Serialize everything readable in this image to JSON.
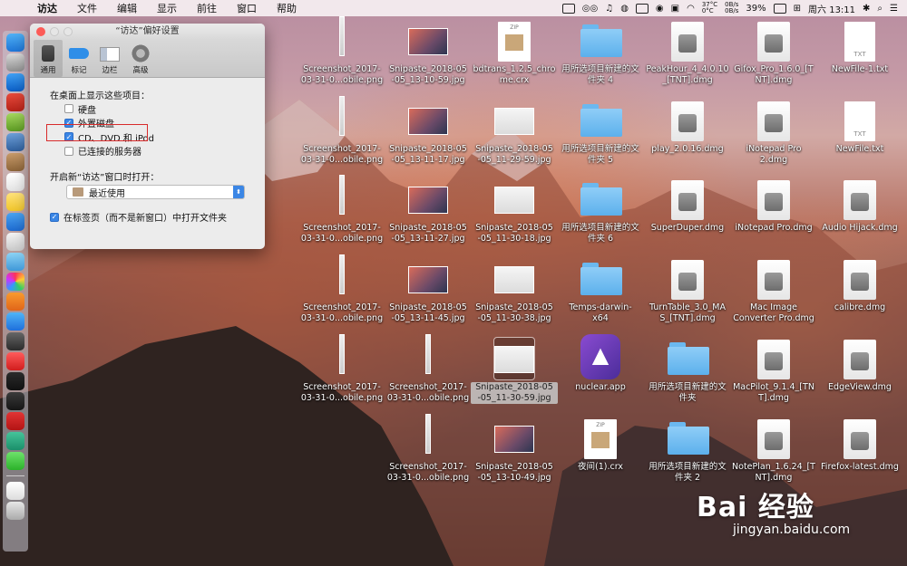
{
  "menubar": {
    "apple": "",
    "items": [
      "访达",
      "文件",
      "编辑",
      "显示",
      "前往",
      "窗口",
      "帮助"
    ],
    "status": {
      "temp": "37°C",
      "temp_sub": "0°C",
      "net_up": "0B/s",
      "net_down": "0B/s",
      "battery": "39%",
      "datetime": "周六 13:11"
    }
  },
  "prefs": {
    "title": "“访达”偏好设置",
    "tabs": [
      {
        "label": "通用",
        "icon": "general-icon"
      },
      {
        "label": "标记",
        "icon": "tag-icon"
      },
      {
        "label": "边栏",
        "icon": "sidebar-icon"
      },
      {
        "label": "高级",
        "icon": "gear-icon"
      }
    ],
    "section_heading": "在桌面上显示这些项目：",
    "checkboxes": [
      {
        "label": "硬盘",
        "checked": false
      },
      {
        "label": "外置磁盘",
        "checked": true
      },
      {
        "label": "CD、DVD 和 iPod",
        "checked": true
      },
      {
        "label": "已连接的服务器",
        "checked": false
      }
    ],
    "new_window_label": "开启新“访达”窗口时打开：",
    "new_window_value": "最近使用",
    "tabs_option": {
      "label": "在标签页（而不是新窗口）中打开文件夹",
      "checked": true
    }
  },
  "desktop": {
    "icons": [
      {
        "label": "Screenshot_2017-\n03-31-0...obile.png",
        "kind": "shot-tall"
      },
      {
        "label": "Screenshot_2017-\n03-31-0...obile.png",
        "kind": "shot-tall"
      },
      {
        "label": "Screenshot_2017-\n03-31-0...obile.png",
        "kind": "shot-tall"
      },
      {
        "label": "Screenshot_2017-\n03-31-0...obile.png",
        "kind": "shot-tall"
      },
      {
        "label": "Screenshot_2017-\n03-31-0...obile.png",
        "kind": "shot-tall"
      },
      {
        "label": "Snipaste_2018-05\n-05_13-10-59.jpg",
        "kind": "snip"
      },
      {
        "label": "Snipaste_2018-05\n-05_13-11-17.jpg",
        "kind": "snip"
      },
      {
        "label": "Snipaste_2018-05\n-05_13-11-27.jpg",
        "kind": "snip"
      },
      {
        "label": "Snipaste_2018-05\n-05_13-11-45.jpg",
        "kind": "snip"
      },
      {
        "label": "Screenshot_2017-\n03-31-0...obile.png",
        "kind": "shot-tall"
      },
      {
        "label": "Screenshot_2017-\n03-31-0...obile.png",
        "kind": "shot-tall"
      },
      {
        "label": "bdtrans_1.2.5_chro\nme.crx",
        "kind": "zip"
      },
      {
        "label": "Snipaste_2018-05\n-05_11-29-59.jpg",
        "kind": "snip-white"
      },
      {
        "label": "Snipaste_2018-05\n-05_11-30-18.jpg",
        "kind": "snip-white"
      },
      {
        "label": "Snipaste_2018-05\n-05_11-30-38.jpg",
        "kind": "snip-white"
      },
      {
        "label": "Snipaste_2018-05\n-05_11-30-59.jpg",
        "kind": "snip-white",
        "selected": true
      },
      {
        "label": "Snipaste_2018-05\n-05_13-10-49.jpg",
        "kind": "snip"
      },
      {
        "label": "用所选项目新建的文\n件夹 4",
        "kind": "folder"
      },
      {
        "label": "用所选项目新建的文\n件夹 5",
        "kind": "folder"
      },
      {
        "label": "用所选项目新建的文\n件夹 6",
        "kind": "folder"
      },
      {
        "label": "Temps-darwin-\nx64",
        "kind": "folder"
      },
      {
        "label": "nuclear.app",
        "kind": "nuclear"
      },
      {
        "label": "夜间(1).crx",
        "kind": "zip"
      },
      {
        "label": "PeakHour_4_4.0.10\n_[TNT].dmg",
        "kind": "dmg"
      },
      {
        "label": "play_2.0.16.dmg",
        "kind": "dmg"
      },
      {
        "label": "SuperDuper.dmg",
        "kind": "dmg"
      },
      {
        "label": "TurnTable_3.0_MA\nS_[TNT].dmg",
        "kind": "dmg"
      },
      {
        "label": "用所选项目新建的文\n件夹",
        "kind": "folder"
      },
      {
        "label": "用所选项目新建的文\n件夹 2",
        "kind": "folder"
      },
      {
        "label": "Gifox_Pro_1.6.0_[T\nNT].dmg",
        "kind": "dmg"
      },
      {
        "label": "iNotepad Pro\n2.dmg",
        "kind": "dmg"
      },
      {
        "label": "iNotepad Pro.dmg",
        "kind": "dmg"
      },
      {
        "label": "Mac Image\nConverter Pro.dmg",
        "kind": "dmg"
      },
      {
        "label": "MacPilot_9.1.4_[TN\nT].dmg",
        "kind": "dmg"
      },
      {
        "label": "NotePlan_1.6.24_[T\nNT].dmg",
        "kind": "dmg"
      },
      {
        "label": "NewFile-1.txt",
        "kind": "txt"
      },
      {
        "label": "NewFile.txt",
        "kind": "txt"
      },
      {
        "label": "Audio Hijack.dmg",
        "kind": "dmg"
      },
      {
        "label": "calibre.dmg",
        "kind": "dmg"
      },
      {
        "label": "EdgeView.dmg",
        "kind": "dmg"
      },
      {
        "label": "Firefox-latest.dmg",
        "kind": "dmg"
      }
    ]
  },
  "watermark": {
    "brand": "Bai 经验",
    "url": "jingyan.baidu.com"
  }
}
